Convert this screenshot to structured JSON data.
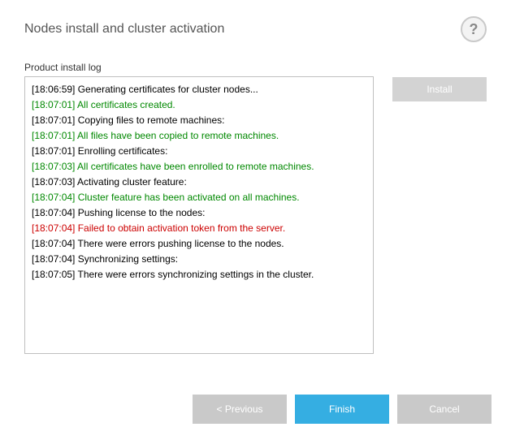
{
  "header": {
    "title": "Nodes install and cluster activation"
  },
  "log": {
    "label": "Product install log",
    "entries": [
      {
        "time": "[18:06:59]",
        "msg": "Generating certificates for cluster nodes...",
        "status": "normal"
      },
      {
        "time": "[18:07:01]",
        "msg": "All certificates created.",
        "status": "green"
      },
      {
        "time": "[18:07:01]",
        "msg": "Copying files to remote machines:",
        "status": "normal"
      },
      {
        "time": "[18:07:01]",
        "msg": "All files have been copied to remote machines.",
        "status": "green"
      },
      {
        "time": "[18:07:01]",
        "msg": "Enrolling certificates:",
        "status": "normal"
      },
      {
        "time": "[18:07:03]",
        "msg": "All certificates have been enrolled to remote machines.",
        "status": "green"
      },
      {
        "time": "[18:07:03]",
        "msg": "Activating cluster feature:",
        "status": "normal"
      },
      {
        "time": "[18:07:04]",
        "msg": "Cluster feature has been activated on all machines.",
        "status": "green"
      },
      {
        "time": "[18:07:04]",
        "msg": "Pushing license to the nodes:",
        "status": "normal"
      },
      {
        "time": "[18:07:04]",
        "msg": "Failed to obtain activation token from the server.",
        "status": "red"
      },
      {
        "time": "[18:07:04]",
        "msg": "There were errors pushing license to the nodes.",
        "status": "normal"
      },
      {
        "time": "[18:07:04]",
        "msg": "Synchronizing settings:",
        "status": "normal"
      },
      {
        "time": "[18:07:05]",
        "msg": "There were errors synchronizing settings in the cluster.",
        "status": "normal"
      }
    ]
  },
  "buttons": {
    "install": "Install",
    "previous": "< Previous",
    "finish": "Finish",
    "cancel": "Cancel"
  }
}
